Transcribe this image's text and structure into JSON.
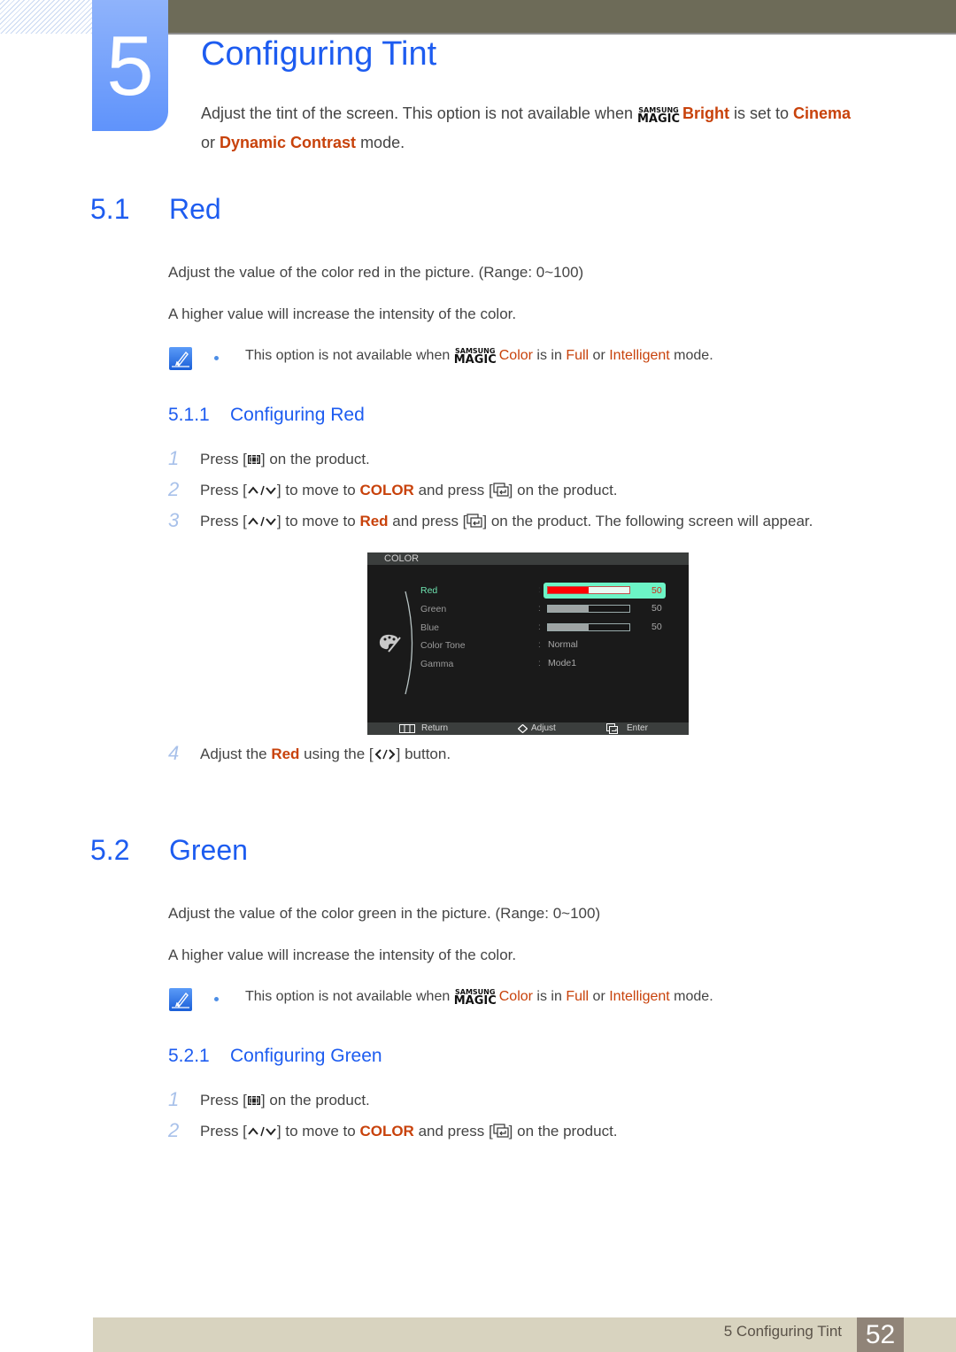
{
  "chapter": {
    "number": "5",
    "title": "Configuring Tint",
    "intro_line1": {
      "prefix": "Adjust the tint of the screen. This option is not available when ",
      "magic_top": "SAMSUNG",
      "magic_bottom": "MAGIC",
      "feature": "Bright",
      "middle": " is set to ",
      "value1": "Cinema"
    },
    "intro_line2": {
      "prefix": "or ",
      "value2": "Dynamic Contrast",
      "suffix": " mode."
    }
  },
  "sections": [
    {
      "number": "5.1",
      "title": "Red",
      "para1": "Adjust the value of the color red in the picture. (Range: 0~100)",
      "para2": "A higher value will increase the intensity of the color.",
      "note": {
        "prefix": "This option is not available when ",
        "magic_top": "SAMSUNG",
        "magic_bottom": "MAGIC",
        "feature": "Color",
        "middle": " is in ",
        "opt1": "Full",
        "or": " or ",
        "opt2": "Intelligent",
        "suffix": " mode."
      },
      "subsection": {
        "number": "5.1.1",
        "title": "Configuring Red",
        "steps": [
          {
            "n": "1",
            "a": "Press [",
            "b": "] on the product."
          },
          {
            "n": "2",
            "a": "Press [",
            "b": "] to move to ",
            "hl": "COLOR",
            "c": " and press [",
            "d": "] on the product."
          },
          {
            "n": "3",
            "a": "Press [",
            "b": "] to move to ",
            "hl": "Red",
            "c": " and press [",
            "d": "] on the product. The following screen will appear."
          },
          {
            "n": "4",
            "a": "Adjust the ",
            "hl": "Red",
            "c": " using the [",
            "d": "] button."
          }
        ]
      }
    },
    {
      "number": "5.2",
      "title": "Green",
      "para1": "Adjust the value of the color green in the picture. (Range: 0~100)",
      "para2": "A higher value will increase the intensity of the color.",
      "note": {
        "prefix": "This option is not available when ",
        "magic_top": "SAMSUNG",
        "magic_bottom": "MAGIC",
        "feature": "Color",
        "middle": " is in ",
        "opt1": "Full",
        "or": " or ",
        "opt2": "Intelligent",
        "suffix": " mode."
      },
      "subsection": {
        "number": "5.2.1",
        "title": "Configuring Green",
        "steps": [
          {
            "n": "1",
            "a": "Press [",
            "b": "] on the product."
          },
          {
            "n": "2",
            "a": "Press [",
            "b": "] to move to ",
            "hl": "COLOR",
            "c": " and press [",
            "d": "] on the product."
          }
        ]
      }
    }
  ],
  "osd": {
    "title": "COLOR",
    "items": [
      {
        "label": "Red",
        "colon": ":",
        "value": "50",
        "percent": 50,
        "selected": true
      },
      {
        "label": "Green",
        "colon": ":",
        "value": "50",
        "percent": 50
      },
      {
        "label": "Blue",
        "colon": ":",
        "value": "50",
        "percent": 50
      },
      {
        "label": "Color Tone",
        "colon": ":",
        "value": "Normal"
      },
      {
        "label": "Gamma",
        "colon": ":",
        "value": "Mode1"
      }
    ],
    "footer": {
      "return": "Return",
      "adjust": "Adjust",
      "enter": "Enter"
    },
    "colors": {
      "selected_row": "#6cf4c6",
      "selected_text": "#6ee3b0",
      "red_fill": "#ff0000"
    }
  },
  "footer": {
    "chapter_label": "5 Configuring Tint",
    "page_number": "52"
  },
  "colors": {
    "heading_blue": "#1d5cf0",
    "highlight_orange": "#c8420b",
    "topbar": "#6d6b58",
    "footer_band": "#d8d3bf",
    "page_box": "#908478"
  }
}
